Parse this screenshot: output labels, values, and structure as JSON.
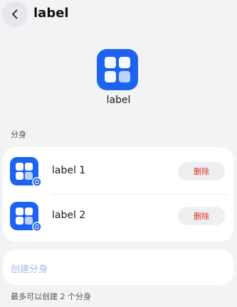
{
  "header": {
    "back_icon": "chevron-left-icon",
    "title": "label"
  },
  "app": {
    "icon": "app-grid-icon",
    "name": "label"
  },
  "clones_section": {
    "label": "分身",
    "items": [
      {
        "label": "label 1",
        "icon": "app-grid-icon",
        "badge_icon": "clone-badge-icon",
        "delete_label": "删除"
      },
      {
        "label": "label 2",
        "icon": "app-grid-icon",
        "badge_icon": "clone-badge-icon",
        "delete_label": "删除"
      }
    ]
  },
  "create": {
    "label": "创建分身"
  },
  "hint": "最多可以创建 2 个分身",
  "colors": {
    "accent": "#1e63f0",
    "danger": "#e0302a",
    "background": "#f1f3f5",
    "muted_link": "#9fbbe8"
  }
}
